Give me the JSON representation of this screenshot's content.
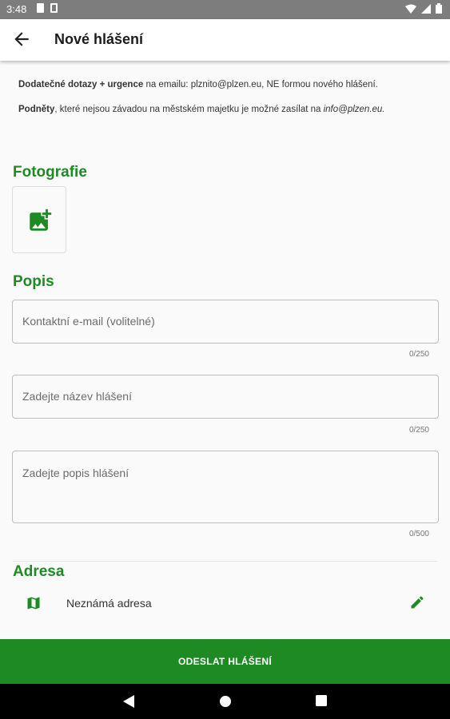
{
  "status_bar": {
    "time": "3:48"
  },
  "app_bar": {
    "title": "Nové hlášení"
  },
  "info": {
    "line1_bold": "Dodatečné dotazy + urgence",
    "line1_rest": " na emailu: plznito@plzen.eu, NE formou nového hlášení.",
    "line2_bold": "Podněty",
    "line2_rest": ", které nejsou závadou na městském majetku je možné zasílat na ",
    "line2_italic": "info@plzen.eu."
  },
  "photos": {
    "title": "Fotografie",
    "add_icon": "add-photo-icon"
  },
  "description": {
    "title": "Popis",
    "fields": [
      {
        "placeholder": "Kontaktní e-mail (volitelné)",
        "value": "",
        "counter": "0/250"
      },
      {
        "placeholder": "Zadejte název hlášení",
        "value": "",
        "counter": "0/250"
      },
      {
        "placeholder": "Zadejte popis hlášení",
        "value": "",
        "counter": "0/500"
      }
    ]
  },
  "address": {
    "title": "Adresa",
    "value": "Neznámá adresa",
    "map_icon": "map-icon",
    "edit_icon": "edit-icon"
  },
  "submit": {
    "label": "ODESLAT HLÁŠENÍ"
  },
  "colors": {
    "accent": "#1e8a24",
    "statusbar": "#7d7d7d",
    "background": "#fafafa"
  }
}
